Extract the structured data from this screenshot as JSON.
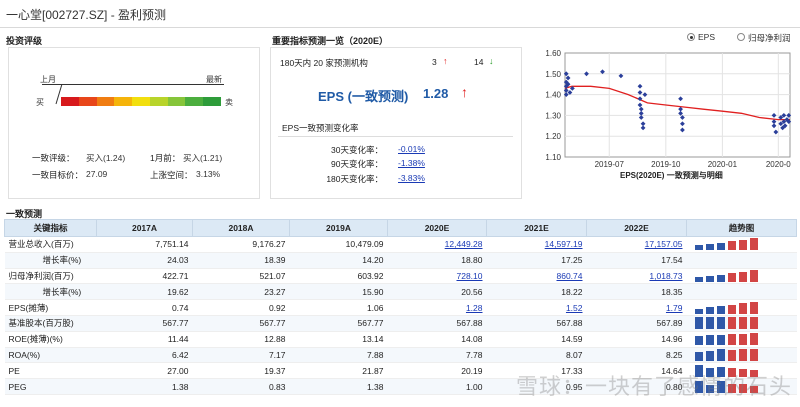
{
  "page": {
    "title": "一心堂[002727.SZ] - 盈利预测"
  },
  "rating": {
    "section_title": "投资评级",
    "last_month_label": "上月",
    "latest_label": "最新",
    "buy_label": "买",
    "sell_label": "卖",
    "scale_colors": [
      "#d7191c",
      "#e8461a",
      "#f07d12",
      "#f5b40a",
      "#f2df0e",
      "#b8d42a",
      "#86c53a",
      "#4cae3e",
      "#2e9c3a"
    ],
    "consensus_rating_label": "一致评级：",
    "consensus_rating_value": "买入(1.24)",
    "month_ago_label": "1月前：",
    "month_ago_value": "买入(1.21)",
    "target_price_label": "一致目标价：",
    "target_price_value": "27.09",
    "upside_label": "上涨空间：",
    "upside_value": "3.13%"
  },
  "key_indicators": {
    "section_title": "重要指标预测一览（2020E）",
    "institutions_text": "180天内 20 家预测机构",
    "up_count": "3",
    "down_count": "14",
    "eps_label": "EPS (一致预测)",
    "eps_value": "1.28",
    "change_title": "EPS一致预测变化率",
    "changes": [
      {
        "label": "30天变化率：",
        "value": "-0.01%"
      },
      {
        "label": "90天变化率：",
        "value": "-1.38%"
      },
      {
        "label": "180天变化率：",
        "value": "-3.83%"
      }
    ]
  },
  "chart_toggle": {
    "option_eps": "EPS",
    "option_profit": "归母净利润",
    "selected": "EPS"
  },
  "chart_data": {
    "type": "scatter",
    "title": "EPS(2020E) 一致预测与明细",
    "x_ticks": [
      "2019-07",
      "2019-10",
      "2020-01",
      "2020-0"
    ],
    "y_ticks": [
      "1.10",
      "1.20",
      "1.30",
      "1.40",
      "1.50",
      "1.60"
    ],
    "ylim": [
      1.1,
      1.6
    ],
    "xlim": [
      "2019-04-20",
      "2020-04-20"
    ],
    "grid": true,
    "line_color": "#e02020",
    "point_color": "#2b3f9a",
    "consensus_line": [
      {
        "x": "2019-04-20",
        "y": 1.43
      },
      {
        "x": "2019-05-01",
        "y": 1.44
      },
      {
        "x": "2019-06-01",
        "y": 1.44
      },
      {
        "x": "2019-07-01",
        "y": 1.43
      },
      {
        "x": "2019-08-01",
        "y": 1.4
      },
      {
        "x": "2019-09-01",
        "y": 1.36
      },
      {
        "x": "2019-10-01",
        "y": 1.35
      },
      {
        "x": "2019-11-01",
        "y": 1.34
      },
      {
        "x": "2019-12-01",
        "y": 1.33
      },
      {
        "x": "2020-01-01",
        "y": 1.32
      },
      {
        "x": "2020-02-01",
        "y": 1.31
      },
      {
        "x": "2020-03-01",
        "y": 1.29
      },
      {
        "x": "2020-04-01",
        "y": 1.28
      },
      {
        "x": "2020-04-20",
        "y": 1.28
      }
    ],
    "points": [
      {
        "x": "2019-04-22",
        "y": 1.5
      },
      {
        "x": "2019-04-22",
        "y": 1.46
      },
      {
        "x": "2019-04-22",
        "y": 1.44
      },
      {
        "x": "2019-04-22",
        "y": 1.42
      },
      {
        "x": "2019-04-22",
        "y": 1.4
      },
      {
        "x": "2019-04-25",
        "y": 1.48
      },
      {
        "x": "2019-04-25",
        "y": 1.45
      },
      {
        "x": "2019-04-28",
        "y": 1.41
      },
      {
        "x": "2019-05-02",
        "y": 1.43
      },
      {
        "x": "2019-05-25",
        "y": 1.5
      },
      {
        "x": "2019-06-20",
        "y": 1.51
      },
      {
        "x": "2019-07-20",
        "y": 1.49
      },
      {
        "x": "2019-08-20",
        "y": 1.44
      },
      {
        "x": "2019-08-20",
        "y": 1.41
      },
      {
        "x": "2019-08-20",
        "y": 1.38
      },
      {
        "x": "2019-08-20",
        "y": 1.35
      },
      {
        "x": "2019-08-22",
        "y": 1.33
      },
      {
        "x": "2019-08-22",
        "y": 1.31
      },
      {
        "x": "2019-08-22",
        "y": 1.29
      },
      {
        "x": "2019-08-25",
        "y": 1.26
      },
      {
        "x": "2019-08-25",
        "y": 1.24
      },
      {
        "x": "2019-08-28",
        "y": 1.4
      },
      {
        "x": "2019-10-25",
        "y": 1.38
      },
      {
        "x": "2019-10-25",
        "y": 1.33
      },
      {
        "x": "2019-10-25",
        "y": 1.31
      },
      {
        "x": "2019-10-28",
        "y": 1.29
      },
      {
        "x": "2019-10-28",
        "y": 1.26
      },
      {
        "x": "2019-10-28",
        "y": 1.23
      },
      {
        "x": "2020-03-25",
        "y": 1.3
      },
      {
        "x": "2020-03-25",
        "y": 1.27
      },
      {
        "x": "2020-03-25",
        "y": 1.25
      },
      {
        "x": "2020-03-28",
        "y": 1.22
      },
      {
        "x": "2020-04-05",
        "y": 1.29
      },
      {
        "x": "2020-04-05",
        "y": 1.26
      },
      {
        "x": "2020-04-08",
        "y": 1.24
      },
      {
        "x": "2020-04-10",
        "y": 1.3
      },
      {
        "x": "2020-04-10",
        "y": 1.27
      },
      {
        "x": "2020-04-12",
        "y": 1.25
      },
      {
        "x": "2020-04-15",
        "y": 1.28
      },
      {
        "x": "2020-04-18",
        "y": 1.3
      },
      {
        "x": "2020-04-18",
        "y": 1.27
      }
    ]
  },
  "table": {
    "section_title": "一致预测",
    "headers": [
      "关键指标",
      "2017A",
      "2018A",
      "2019A",
      "2020E",
      "2021E",
      "2022E",
      "趋势图"
    ],
    "rows": [
      {
        "label": "营业总收入(百万)",
        "sub": false,
        "values": [
          "7,751.14",
          "9,176.27",
          "10,479.09",
          "12,449.28",
          "14,597.19",
          "17,157.05"
        ],
        "links": [
          false,
          false,
          false,
          true,
          true,
          true
        ],
        "trend": [
          0.45,
          0.55,
          0.65,
          0.78,
          0.9,
          1.0
        ]
      },
      {
        "label": "增长率(%)",
        "sub": true,
        "values": [
          "24.03",
          "18.39",
          "14.20",
          "18.80",
          "17.25",
          "17.54"
        ],
        "links": [
          false,
          false,
          false,
          false,
          false,
          false
        ],
        "trend": []
      },
      {
        "label": "归母净利润(百万)",
        "sub": false,
        "values": [
          "422.71",
          "521.07",
          "603.92",
          "728.10",
          "860.74",
          "1,018.73"
        ],
        "links": [
          false,
          false,
          false,
          true,
          true,
          true
        ],
        "trend": [
          0.42,
          0.51,
          0.6,
          0.72,
          0.85,
          1.0
        ]
      },
      {
        "label": "增长率(%)",
        "sub": true,
        "values": [
          "19.62",
          "23.27",
          "15.90",
          "20.56",
          "18.22",
          "18.35"
        ],
        "links": [
          false,
          false,
          false,
          false,
          false,
          false
        ],
        "trend": []
      },
      {
        "label": "EPS(摊薄)",
        "sub": false,
        "values": [
          "0.74",
          "0.92",
          "1.06",
          "1.28",
          "1.52",
          "1.79"
        ],
        "links": [
          false,
          false,
          false,
          true,
          true,
          true
        ],
        "trend": [
          0.42,
          0.51,
          0.6,
          0.72,
          0.85,
          1.0
        ]
      },
      {
        "label": "基准股本(百万股)",
        "sub": false,
        "values": [
          "567.77",
          "567.77",
          "567.77",
          "567.88",
          "567.88",
          "567.89"
        ],
        "links": [
          false,
          false,
          false,
          false,
          false,
          false
        ],
        "trend": [
          1.0,
          1.0,
          1.0,
          1.0,
          1.0,
          1.0
        ]
      },
      {
        "label": "ROE(摊薄)(%)",
        "sub": false,
        "values": [
          "11.44",
          "12.88",
          "13.14",
          "14.08",
          "14.59",
          "14.96"
        ],
        "links": [
          false,
          false,
          false,
          false,
          false,
          false
        ],
        "trend": [
          0.76,
          0.86,
          0.88,
          0.94,
          0.97,
          1.0
        ]
      },
      {
        "label": "ROA(%)",
        "sub": false,
        "values": [
          "6.42",
          "7.17",
          "7.88",
          "7.78",
          "8.07",
          "8.25"
        ],
        "links": [
          false,
          false,
          false,
          false,
          false,
          false
        ],
        "trend": [
          0.78,
          0.87,
          0.96,
          0.94,
          0.98,
          1.0
        ]
      },
      {
        "label": "PE",
        "sub": false,
        "values": [
          "27.00",
          "19.37",
          "21.87",
          "20.19",
          "17.33",
          "14.64"
        ],
        "links": [
          false,
          false,
          false,
          false,
          false,
          false
        ],
        "trend": [
          1.0,
          0.72,
          0.81,
          0.75,
          0.64,
          0.54
        ]
      },
      {
        "label": "PEG",
        "sub": false,
        "values": [
          "1.38",
          "0.83",
          "1.38",
          "1.00",
          "0.95",
          "0.80"
        ],
        "links": [
          false,
          false,
          false,
          false,
          false,
          false
        ],
        "trend": [
          1.0,
          0.6,
          1.0,
          0.72,
          0.69,
          0.58
        ]
      }
    ],
    "trend_colors": {
      "actual": "#2f58a8",
      "estimate": "#d24545"
    }
  },
  "watermark": {
    "text": "雪球：一块有了感情的石头"
  }
}
